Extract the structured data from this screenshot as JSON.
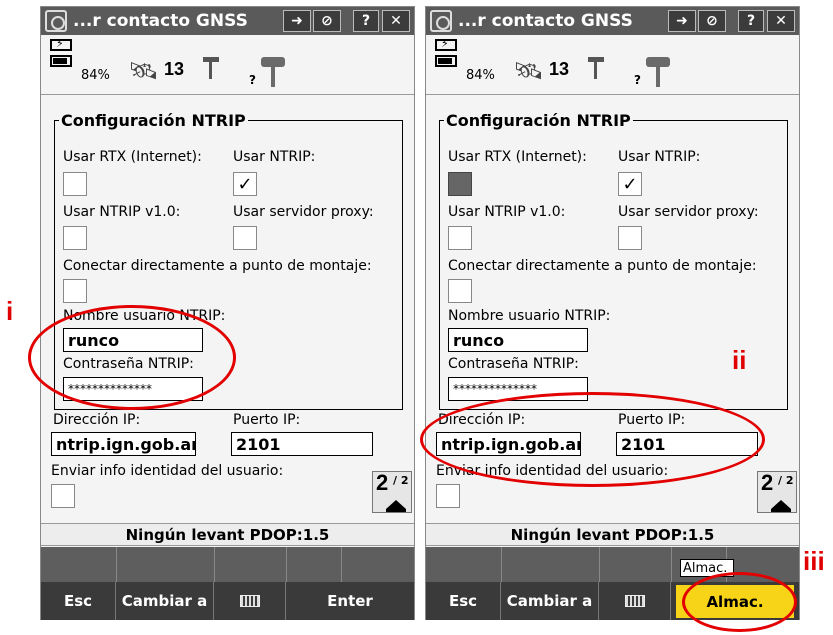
{
  "window": {
    "title": "...r contacto GNSS",
    "buttons": [
      "?",
      "✕"
    ]
  },
  "status": {
    "battery_pct": "84%",
    "satellites": "13",
    "question_mark": "?"
  },
  "group": {
    "title": "Configuración NTRIP"
  },
  "labels": {
    "use_rtx": "Usar RTX (Internet):",
    "use_ntrip": "Usar NTRIP:",
    "use_ntrip_v1": "Usar NTRIP v1.0:",
    "use_proxy": "Usar servidor proxy:",
    "connect_mount": "Conectar directamente a punto de montaje:",
    "username": "Nombre usuario NTRIP:",
    "password": "Contraseña NTRIP:",
    "ip_address": "Dirección IP:",
    "ip_port": "Puerto IP:",
    "send_identity": "Enviar info identidad del usuario:"
  },
  "values": {
    "username": "runco",
    "password": "**************",
    "ip_address": "ntrip.ign.gob.ar",
    "ip_port": "2101",
    "use_ntrip_check": "✓"
  },
  "page": {
    "current": "2",
    "total": "/ 2"
  },
  "statusline": "Ningún levant  PDOP:1.5",
  "softkeys": {
    "esc": "Esc",
    "switch": "Cambiar a",
    "enter": "Enter",
    "store": "Almac."
  },
  "tooltip": "Almac.",
  "annotations": {
    "i": "i",
    "ii": "ii",
    "iii": "iii",
    "color": "#e00000"
  }
}
